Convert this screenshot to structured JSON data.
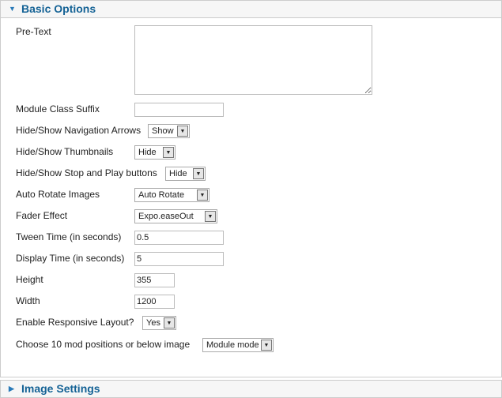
{
  "sections": {
    "basic": "Basic Options",
    "image": "Image Settings"
  },
  "fields": {
    "pretext": {
      "label": "Pre-Text",
      "value": ""
    },
    "suffix": {
      "label": "Module Class Suffix",
      "value": ""
    },
    "nav": {
      "label": "Hide/Show Navigation Arrows",
      "value": "Show"
    },
    "thumbs": {
      "label": "Hide/Show Thumbnails",
      "value": "Hide"
    },
    "stopplay": {
      "label": "Hide/Show Stop and Play buttons",
      "value": "Hide"
    },
    "autorotate": {
      "label": "Auto Rotate Images",
      "value": "Auto Rotate"
    },
    "fader": {
      "label": "Fader Effect",
      "value": "Expo.easeOut"
    },
    "tween": {
      "label": "Tween Time (in seconds)",
      "value": "0.5"
    },
    "display": {
      "label": "Display Time (in seconds)",
      "value": "5"
    },
    "height": {
      "label": "Height",
      "value": "355"
    },
    "width": {
      "label": "Width",
      "value": "1200"
    },
    "responsive": {
      "label": "Enable Responsive Layout?",
      "value": "Yes"
    },
    "positions": {
      "label": "Choose 10 mod positions or below image",
      "value": "Module mode"
    }
  }
}
